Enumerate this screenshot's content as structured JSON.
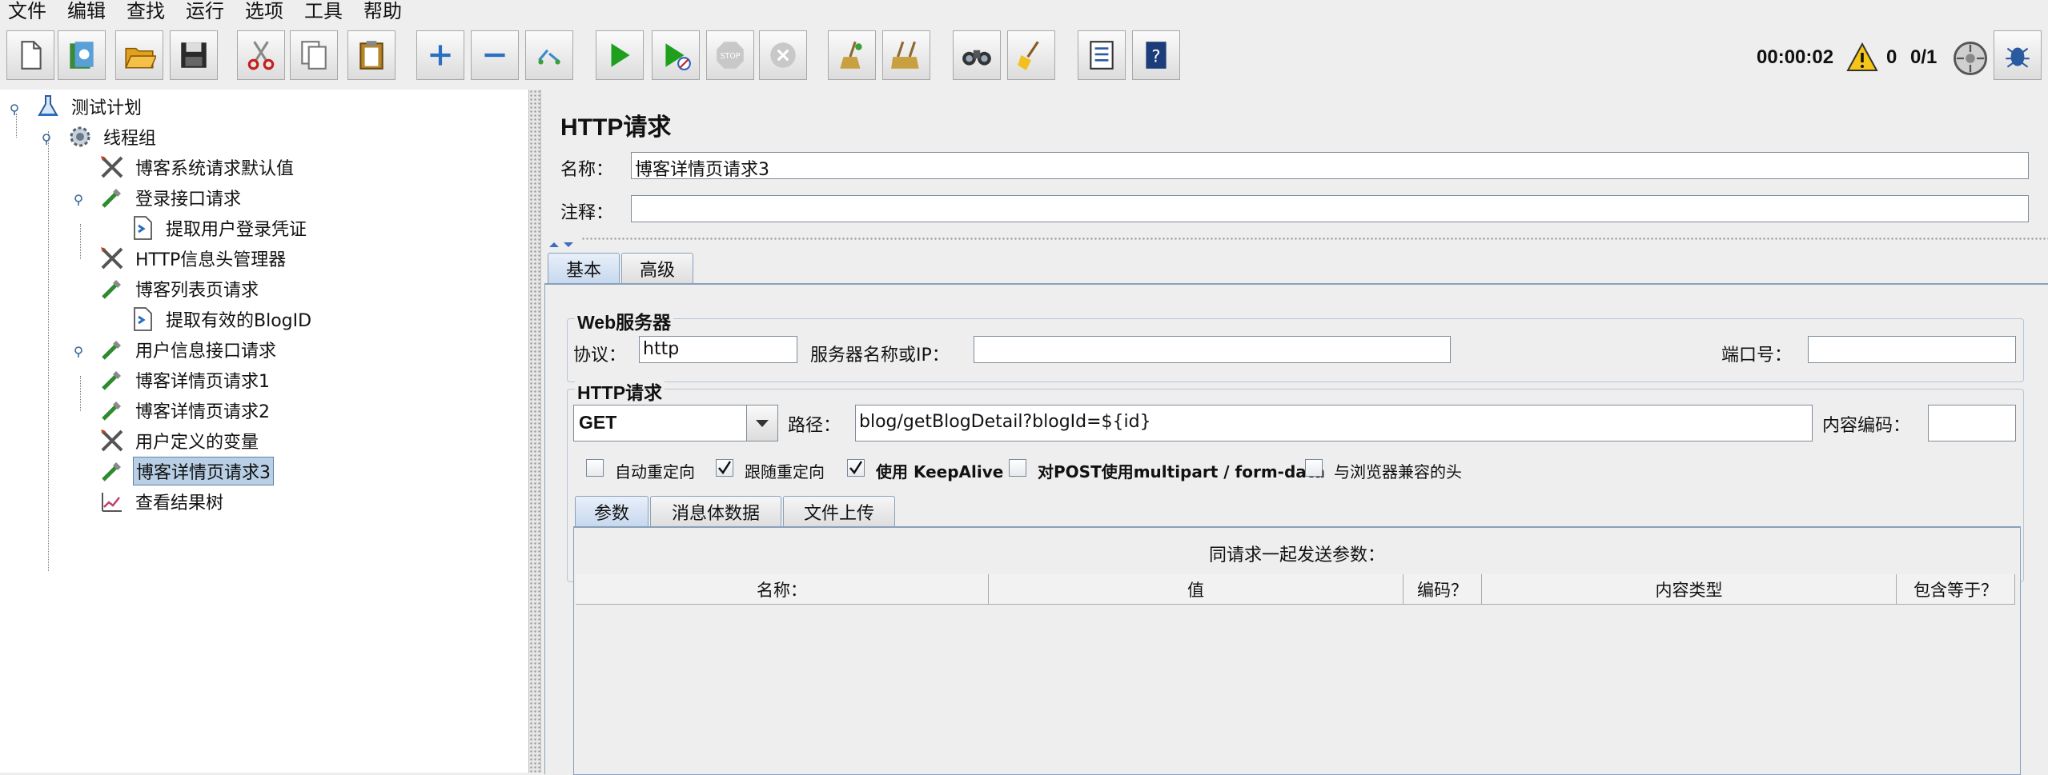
{
  "menu": [
    "文件",
    "编辑",
    "查找",
    "运行",
    "选项",
    "工具",
    "帮助"
  ],
  "toolbar": {
    "buttons": [
      "new-icon",
      "templates-icon",
      "open-icon",
      "save-icon",
      "cut-icon",
      "copy-icon",
      "paste-icon",
      "expand-icon",
      "collapse-icon",
      "toggle-icon",
      "start-icon",
      "start-no-pause-icon",
      "stop-icon",
      "shutdown-icon",
      "clear-icon",
      "clear-all-icon",
      "search-icon",
      "reset-search-icon",
      "function-helper-icon",
      "help-icon"
    ],
    "timer": "00:00:02",
    "warning_count": "0",
    "threads": "0/1"
  },
  "tree": {
    "items": [
      {
        "label": "测试计划",
        "icon": "test-plan-icon",
        "level": 0
      },
      {
        "label": "线程组",
        "icon": "thread-group-icon",
        "level": 1
      },
      {
        "label": "博客系统请求默认值",
        "icon": "config-element-icon",
        "level": 2
      },
      {
        "label": "登录接口请求",
        "icon": "http-sampler-icon",
        "level": 2
      },
      {
        "label": "提取用户登录凭证",
        "icon": "post-processor-icon",
        "level": 3
      },
      {
        "label": "HTTP信息头管理器",
        "icon": "config-element-icon",
        "level": 2
      },
      {
        "label": "博客列表页请求",
        "icon": "http-sampler-icon",
        "level": 2
      },
      {
        "label": "提取有效的BlogID",
        "icon": "post-processor-icon",
        "level": 3
      },
      {
        "label": "用户信息接口请求",
        "icon": "http-sampler-icon",
        "level": 2
      },
      {
        "label": "博客详情页请求1",
        "icon": "http-sampler-icon",
        "level": 2
      },
      {
        "label": "博客详情页请求2",
        "icon": "http-sampler-icon",
        "level": 2
      },
      {
        "label": "用户定义的变量",
        "icon": "config-element-icon",
        "level": 2
      },
      {
        "label": "博客详情页请求3",
        "icon": "http-sampler-icon",
        "level": 2,
        "selected": true
      },
      {
        "label": "查看结果树",
        "icon": "listener-icon",
        "level": 2
      }
    ]
  },
  "panel": {
    "title": "HTTP请求",
    "name_label": "名称：",
    "name_value": "博客详情页请求3",
    "comment_label": "注释：",
    "comment_value": "",
    "tabs": [
      "基本",
      "高级"
    ],
    "web_server": {
      "title": "Web服务器",
      "protocol_label": "协议：",
      "protocol_value": "http",
      "server_label": "服务器名称或IP：",
      "server_value": "",
      "port_label": "端口号：",
      "port_value": ""
    },
    "http_request": {
      "title": "HTTP请求",
      "method": "GET",
      "path_label": "路径：",
      "path_value": "blog/getBlogDetail?blogId=${id}",
      "encoding_label": "内容编码：",
      "encoding_value": ""
    },
    "checkboxes": [
      {
        "label": "自动重定向",
        "checked": false
      },
      {
        "label": "跟随重定向",
        "checked": true
      },
      {
        "label": "使用 KeepAlive",
        "checked": true
      },
      {
        "label": "对POST使用multipart / form-data",
        "checked": false
      },
      {
        "label": "与浏览器兼容的头",
        "checked": false
      }
    ],
    "sub_tabs": [
      "参数",
      "消息体数据",
      "文件上传"
    ],
    "params_caption": "同请求一起发送参数：",
    "columns": [
      "名称：",
      "值",
      "编码？",
      "内容类型",
      "包含等于？"
    ]
  }
}
